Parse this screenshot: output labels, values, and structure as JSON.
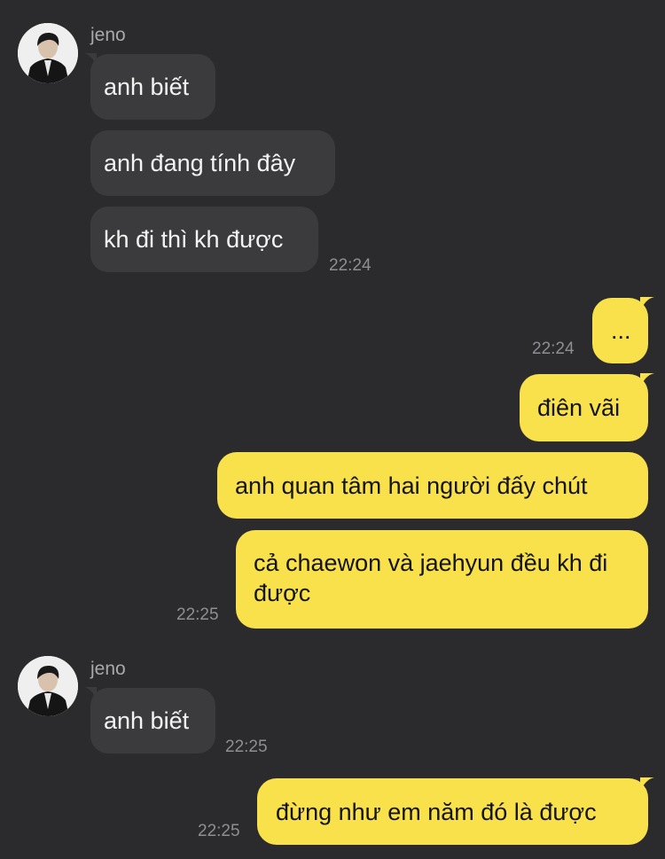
{
  "colors": {
    "background": "#2b2b2d",
    "incoming_bubble": "#3b3b3e",
    "outgoing_bubble": "#f8e14b",
    "timestamp": "#8e8e93",
    "sender_name": "#a9a9ad"
  },
  "chat": {
    "group1": {
      "sender": "jeno",
      "messages": [
        "anh biết",
        "anh đang tính đây",
        "kh đi thì kh được"
      ],
      "time": "22:24"
    },
    "group2": {
      "messages": [
        "...",
        "điên vãi",
        "anh quan tâm hai người đấy chút",
        "cả chaewon và jaehyun đều kh đi được"
      ],
      "time_first": "22:24",
      "time_last": "22:25"
    },
    "group3": {
      "sender": "jeno",
      "messages": [
        "anh biết"
      ],
      "time": "22:25"
    },
    "group4": {
      "messages": [
        "đừng như em năm đó là được"
      ],
      "time": "22:25"
    }
  }
}
